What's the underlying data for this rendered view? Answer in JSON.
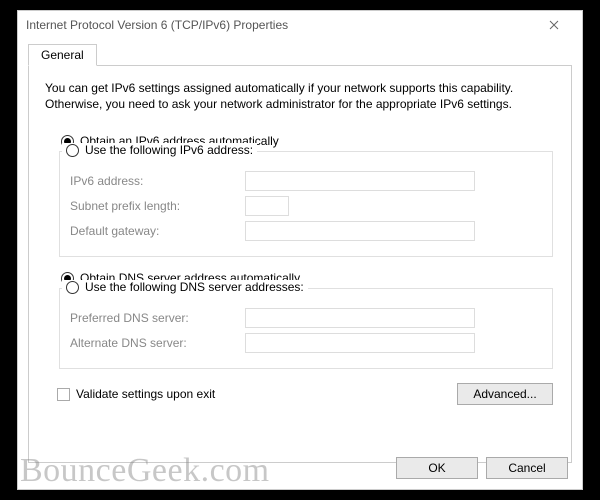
{
  "title": "Internet Protocol Version 6 (TCP/IPv6) Properties",
  "tab": {
    "general": "General"
  },
  "desc": "You can get IPv6 settings assigned automatically if your network supports this capability. Otherwise, you need to ask your network administrator for the appropriate IPv6 settings.",
  "ip": {
    "auto": "Obtain an IPv6 address automatically",
    "manual": "Use the following IPv6 address:",
    "addr_label": "IPv6 address:",
    "addr_value": "",
    "prefix_label": "Subnet prefix length:",
    "prefix_value": "",
    "gateway_label": "Default gateway:",
    "gateway_value": ""
  },
  "dns": {
    "auto": "Obtain DNS server address automatically",
    "manual": "Use the following DNS server addresses:",
    "preferred_label": "Preferred DNS server:",
    "preferred_value": "",
    "alternate_label": "Alternate DNS server:",
    "alternate_value": ""
  },
  "validate": "Validate settings upon exit",
  "buttons": {
    "advanced": "Advanced...",
    "ok": "OK",
    "cancel": "Cancel"
  },
  "watermark": "BounceGeek.com"
}
